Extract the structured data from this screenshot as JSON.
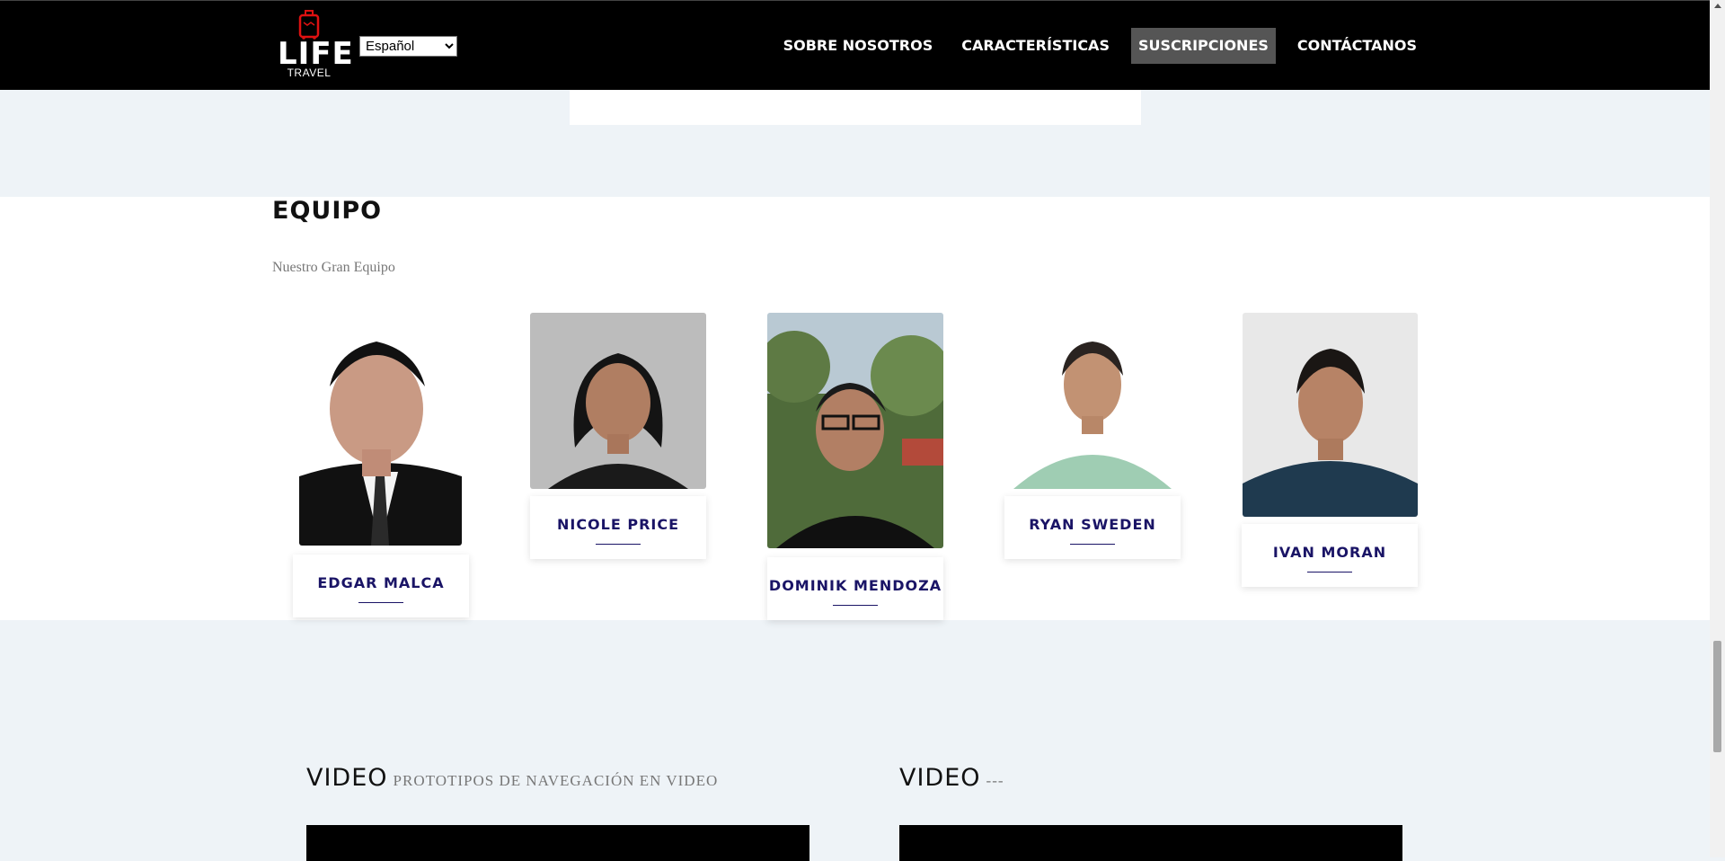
{
  "navbar": {
    "logo_main": "LIFE",
    "logo_sub": "TRAVEL",
    "language_selected": "Español",
    "links": [
      {
        "label": "SOBRE NOSOTROS",
        "active": false
      },
      {
        "label": "CARACTERÍSTICAS",
        "active": false
      },
      {
        "label": "SUSCRIPCIONES",
        "active": true
      },
      {
        "label": "CONTÁCTANOS",
        "active": false
      }
    ]
  },
  "team": {
    "title": "EQUIPO",
    "subtitle": "Nuestro Gran Equipo",
    "members": [
      {
        "name": "EDGAR MALCA"
      },
      {
        "name": "NICOLE PRICE"
      },
      {
        "name": "DOMINIK MENDOZA"
      },
      {
        "name": "RYAN SWEDEN"
      },
      {
        "name": "IVAN MORAN"
      }
    ]
  },
  "videos": [
    {
      "title": "VIDEO",
      "subtitle": "PROTOTIPOS DE NAVEGACIÓN EN VIDEO"
    },
    {
      "title": "VIDEO",
      "subtitle": "---"
    }
  ],
  "colors": {
    "nav_bg": "#000000",
    "nav_active": "#555555",
    "name_color": "#1a1466",
    "page_bg": "#eef3f7"
  }
}
